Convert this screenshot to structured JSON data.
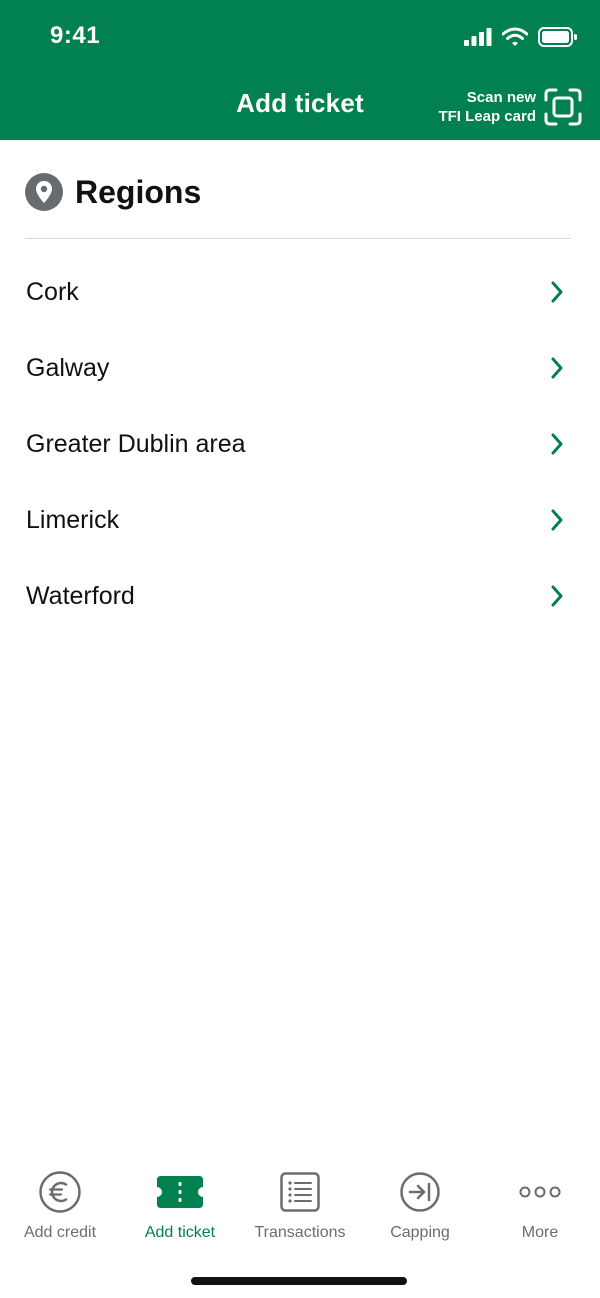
{
  "status_bar": {
    "time": "9:41"
  },
  "header": {
    "title": "Add ticket",
    "scan_line1": "Scan new",
    "scan_line2": "TFI Leap card"
  },
  "section": {
    "title": "Regions",
    "icon": "location-pin-icon"
  },
  "regions": [
    {
      "label": "Cork"
    },
    {
      "label": "Galway"
    },
    {
      "label": "Greater Dublin area"
    },
    {
      "label": "Limerick"
    },
    {
      "label": "Waterford"
    }
  ],
  "tabbar": {
    "tabs": [
      {
        "label": "Add credit",
        "icon": "euro-icon",
        "active": false
      },
      {
        "label": "Add ticket",
        "icon": "ticket-icon",
        "active": true
      },
      {
        "label": "Transactions",
        "icon": "list-icon",
        "active": false
      },
      {
        "label": "Capping",
        "icon": "capping-icon",
        "active": false
      },
      {
        "label": "More",
        "icon": "more-icon",
        "active": false
      }
    ]
  },
  "colors": {
    "brand": "#00814f",
    "inactive": "#6c6c6c"
  }
}
